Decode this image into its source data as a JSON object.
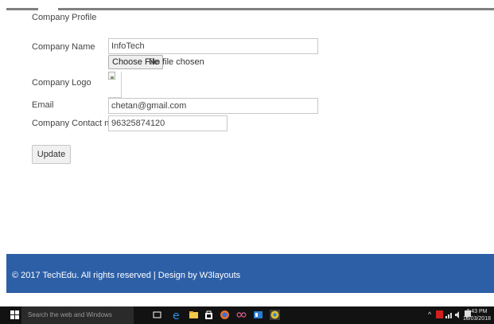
{
  "form": {
    "section_title": "Company Profile",
    "company_name_label": "Company Name",
    "company_name_value": "InfoTech",
    "choose_file_label": "Choose File",
    "no_file_text": "No file chosen",
    "company_logo_label": "Company Logo",
    "email_label": "Email",
    "email_value": "chetan@gmail.com",
    "contact_label": "Company Contact no.",
    "contact_value": "96325874120",
    "update_label": "Update"
  },
  "footer": {
    "text": "© 2017 TechEdu. All rights reserved | Design by W3layouts",
    "background": "#2d5fa7"
  },
  "taskbar": {
    "search_placeholder": "Search the web and Windows",
    "time": "8:43 PM",
    "date": "18/03/2018",
    "icons": [
      "windows-start-icon",
      "task-view-icon",
      "edge-icon",
      "file-explorer-icon",
      "store-icon",
      "firefox-icon",
      "infinity-icon",
      "app-icon",
      "chrome-icon"
    ]
  }
}
